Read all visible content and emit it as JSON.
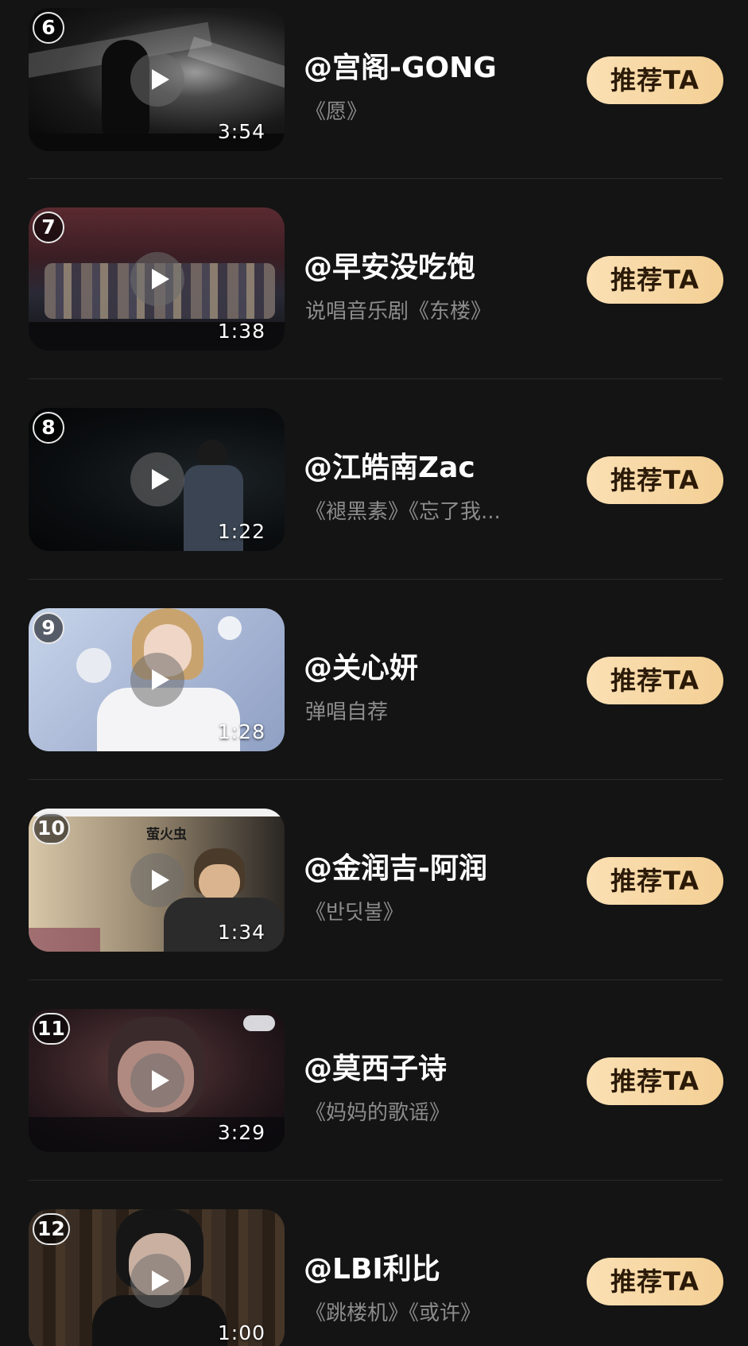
{
  "colors": {
    "background": "#141414",
    "button_gradient": [
      "#fbe0b4",
      "#f3cf94"
    ],
    "button_text": "#2b1a08",
    "subtitle": "#8c8c8c",
    "divider": "#2a2a2a"
  },
  "icons": {
    "play": "play-icon"
  },
  "items": [
    {
      "rank": "6",
      "duration": "3:54",
      "name": "@宫阁-GONG",
      "subtitle": "《愿》",
      "button_label": "推荐TA",
      "caption": ""
    },
    {
      "rank": "7",
      "duration": "1:38",
      "name": "@早安没吃饱",
      "subtitle": "说唱音乐剧《东楼》",
      "button_label": "推荐TA",
      "caption": ""
    },
    {
      "rank": "8",
      "duration": "1:22",
      "name": "@江皓南Zac",
      "subtitle": "《褪黑素》《忘了我...",
      "button_label": "推荐TA",
      "caption": ""
    },
    {
      "rank": "9",
      "duration": "1:28",
      "name": "@关心妍",
      "subtitle": "弹唱自荐",
      "button_label": "推荐TA",
      "caption": ""
    },
    {
      "rank": "10",
      "duration": "1:34",
      "name": "@金润吉-阿润",
      "subtitle": "《반딧불》",
      "button_label": "推荐TA",
      "caption": "萤火虫"
    },
    {
      "rank": "11",
      "duration": "3:29",
      "name": "@莫西子诗",
      "subtitle": "《妈妈的歌谣》",
      "button_label": "推荐TA",
      "caption": ""
    },
    {
      "rank": "12",
      "duration": "1:00",
      "name": "@LBI利比",
      "subtitle": "《跳楼机》《或许》",
      "button_label": "推荐TA",
      "caption": ""
    }
  ]
}
